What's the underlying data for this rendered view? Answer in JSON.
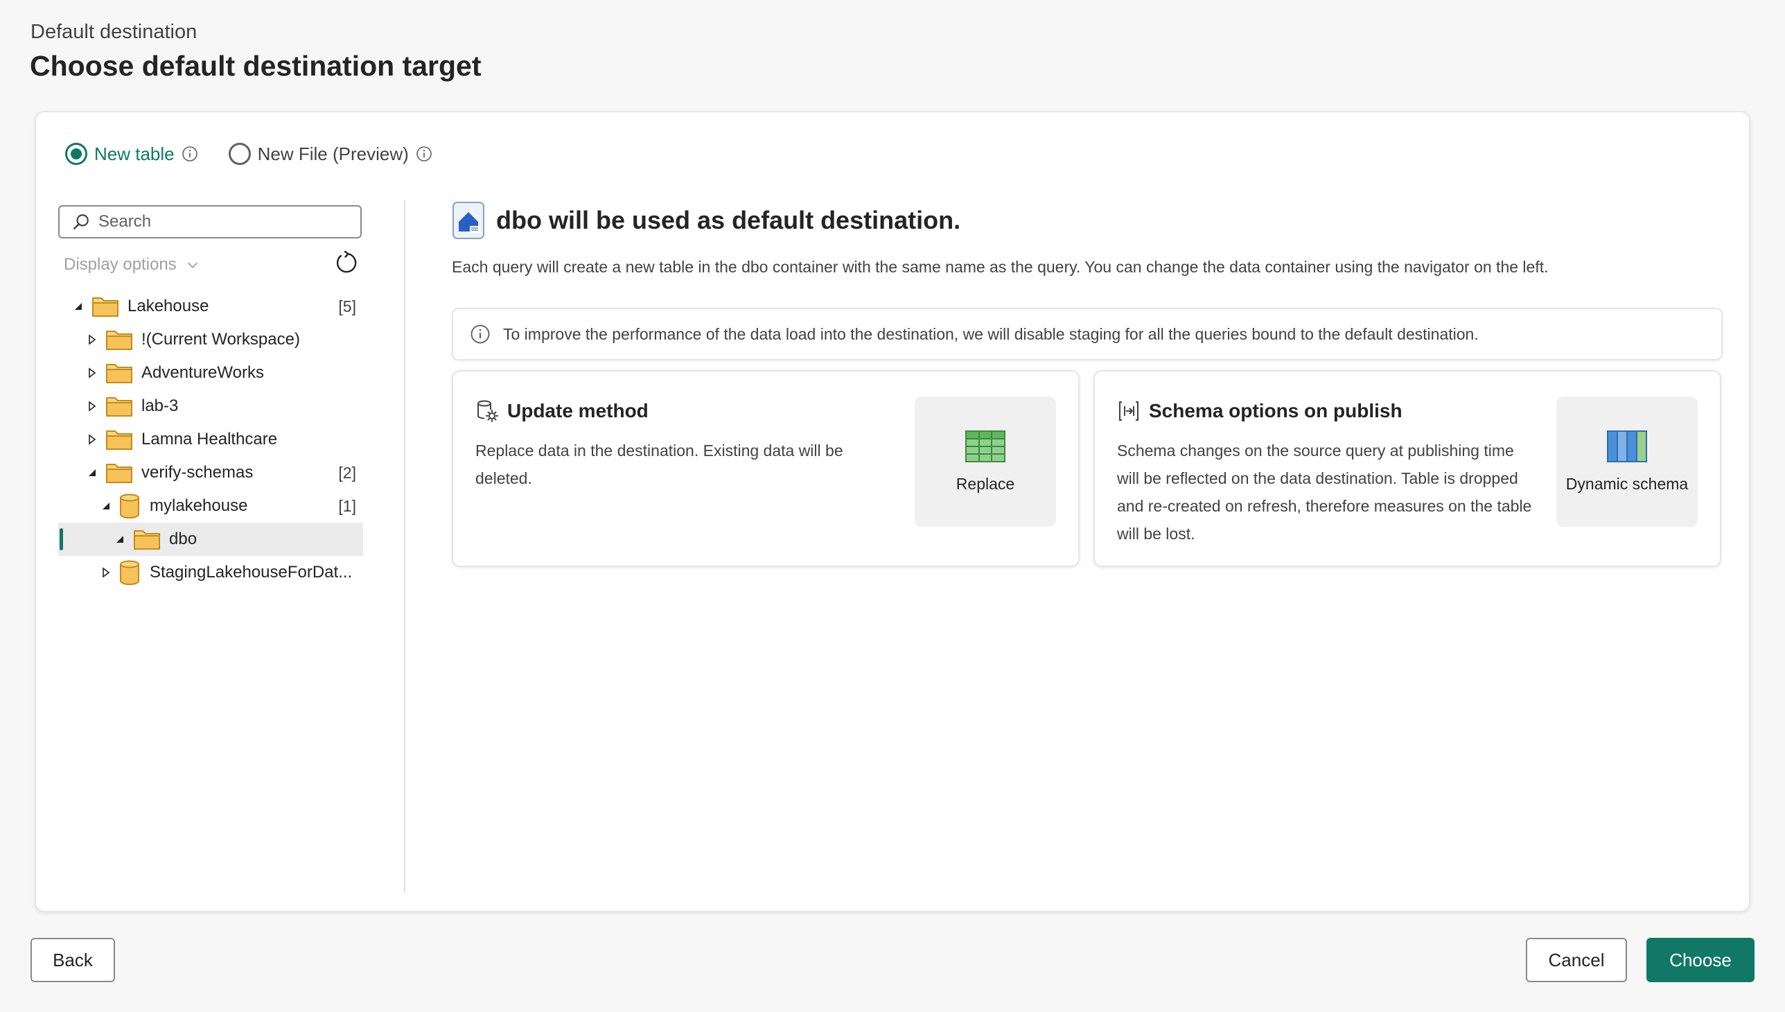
{
  "header": {
    "subtitle": "Default destination",
    "title": "Choose default destination target"
  },
  "target_options": {
    "new_table": "New table",
    "new_file": "New File (Preview)",
    "selected": "New table"
  },
  "navigator": {
    "search_placeholder": "Search",
    "display_options": "Display options",
    "tree": [
      {
        "label": "Lakehouse",
        "count": "[5]",
        "type": "folder",
        "expanded": true,
        "level": 0
      },
      {
        "label": "!(Current Workspace)",
        "count": "",
        "type": "folder",
        "expanded": false,
        "level": 1
      },
      {
        "label": "AdventureWorks",
        "count": "",
        "type": "folder",
        "expanded": false,
        "level": 1
      },
      {
        "label": "lab-3",
        "count": "",
        "type": "folder",
        "expanded": false,
        "level": 1
      },
      {
        "label": "Lamna Healthcare",
        "count": "",
        "type": "folder",
        "expanded": false,
        "level": 1
      },
      {
        "label": "verify-schemas",
        "count": "[2]",
        "type": "folder",
        "expanded": true,
        "level": 1
      },
      {
        "label": "mylakehouse",
        "count": "[1]",
        "type": "database",
        "expanded": true,
        "level": 2
      },
      {
        "label": "dbo",
        "count": "",
        "type": "folder",
        "expanded": true,
        "level": 3,
        "selected": true
      },
      {
        "label": "StagingLakehouseForDat...",
        "count": "",
        "type": "database",
        "expanded": false,
        "level": 2
      }
    ]
  },
  "destination": {
    "title": "dbo will be used as default destination.",
    "description": "Each query will create a new table in the dbo container with the same name as the query. You can change the data container using the navigator on the left.",
    "banner": "To improve the performance of the data load into the destination, we will disable staging for all the queries bound to the default destination."
  },
  "update_method": {
    "title": "Update method",
    "text": "Replace data in the destination. Existing data will be deleted.",
    "tile_label": "Replace"
  },
  "schema_options": {
    "title": "Schema options on publish",
    "text": "Schema changes on the source query at publishing time will be reflected on the data destination. Table is dropped and re-created on refresh, therefore measures on the table will be lost.",
    "tile_label": "Dynamic schema"
  },
  "footer": {
    "back": "Back",
    "cancel": "Cancel",
    "choose": "Choose"
  },
  "colors": {
    "accent": "#117865",
    "folder": "#f6c35b",
    "replace_grid": "#5cb85c",
    "dynamic_schema": "#4a90d9"
  }
}
